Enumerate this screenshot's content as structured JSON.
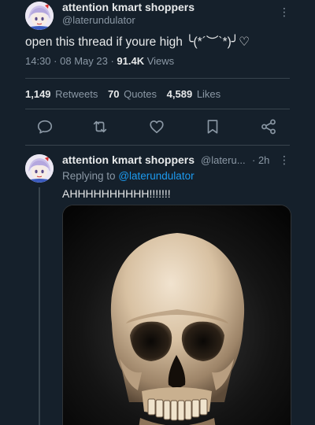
{
  "tweet": {
    "display_name": "attention kmart shoppers",
    "handle": "@laterundulator",
    "text": "open this thread if youre high ╰(*´︶`*)╯♡",
    "time": "14:30",
    "date": "08 May 23",
    "views_count": "91.4K",
    "views_label": "Views",
    "stats": {
      "retweets": {
        "count": "1,149",
        "label": "Retweets"
      },
      "quotes": {
        "count": "70",
        "label": "Quotes"
      },
      "likes": {
        "count": "4,589",
        "label": "Likes"
      }
    }
  },
  "actions": {
    "reply_icon": "speech-bubble-icon",
    "retweet_icon": "retweet-icon",
    "like_icon": "heart-icon",
    "bookmark_icon": "bookmark-icon",
    "share_icon": "share-icon"
  },
  "reply": {
    "display_name": "attention kmart shoppers",
    "handle": "@lateru...",
    "time": "· 2h",
    "replying_prefix": "Replying to",
    "replying_to": "@laterundulator",
    "text": "AHHHHHHHHHH!!!!!!!",
    "media_description": "skull-photo"
  },
  "colors": {
    "background": "#15202b",
    "text_primary": "#e7e9ea",
    "text_secondary": "#8b98a5",
    "link": "#1d9bf0",
    "divider": "#38444d"
  }
}
